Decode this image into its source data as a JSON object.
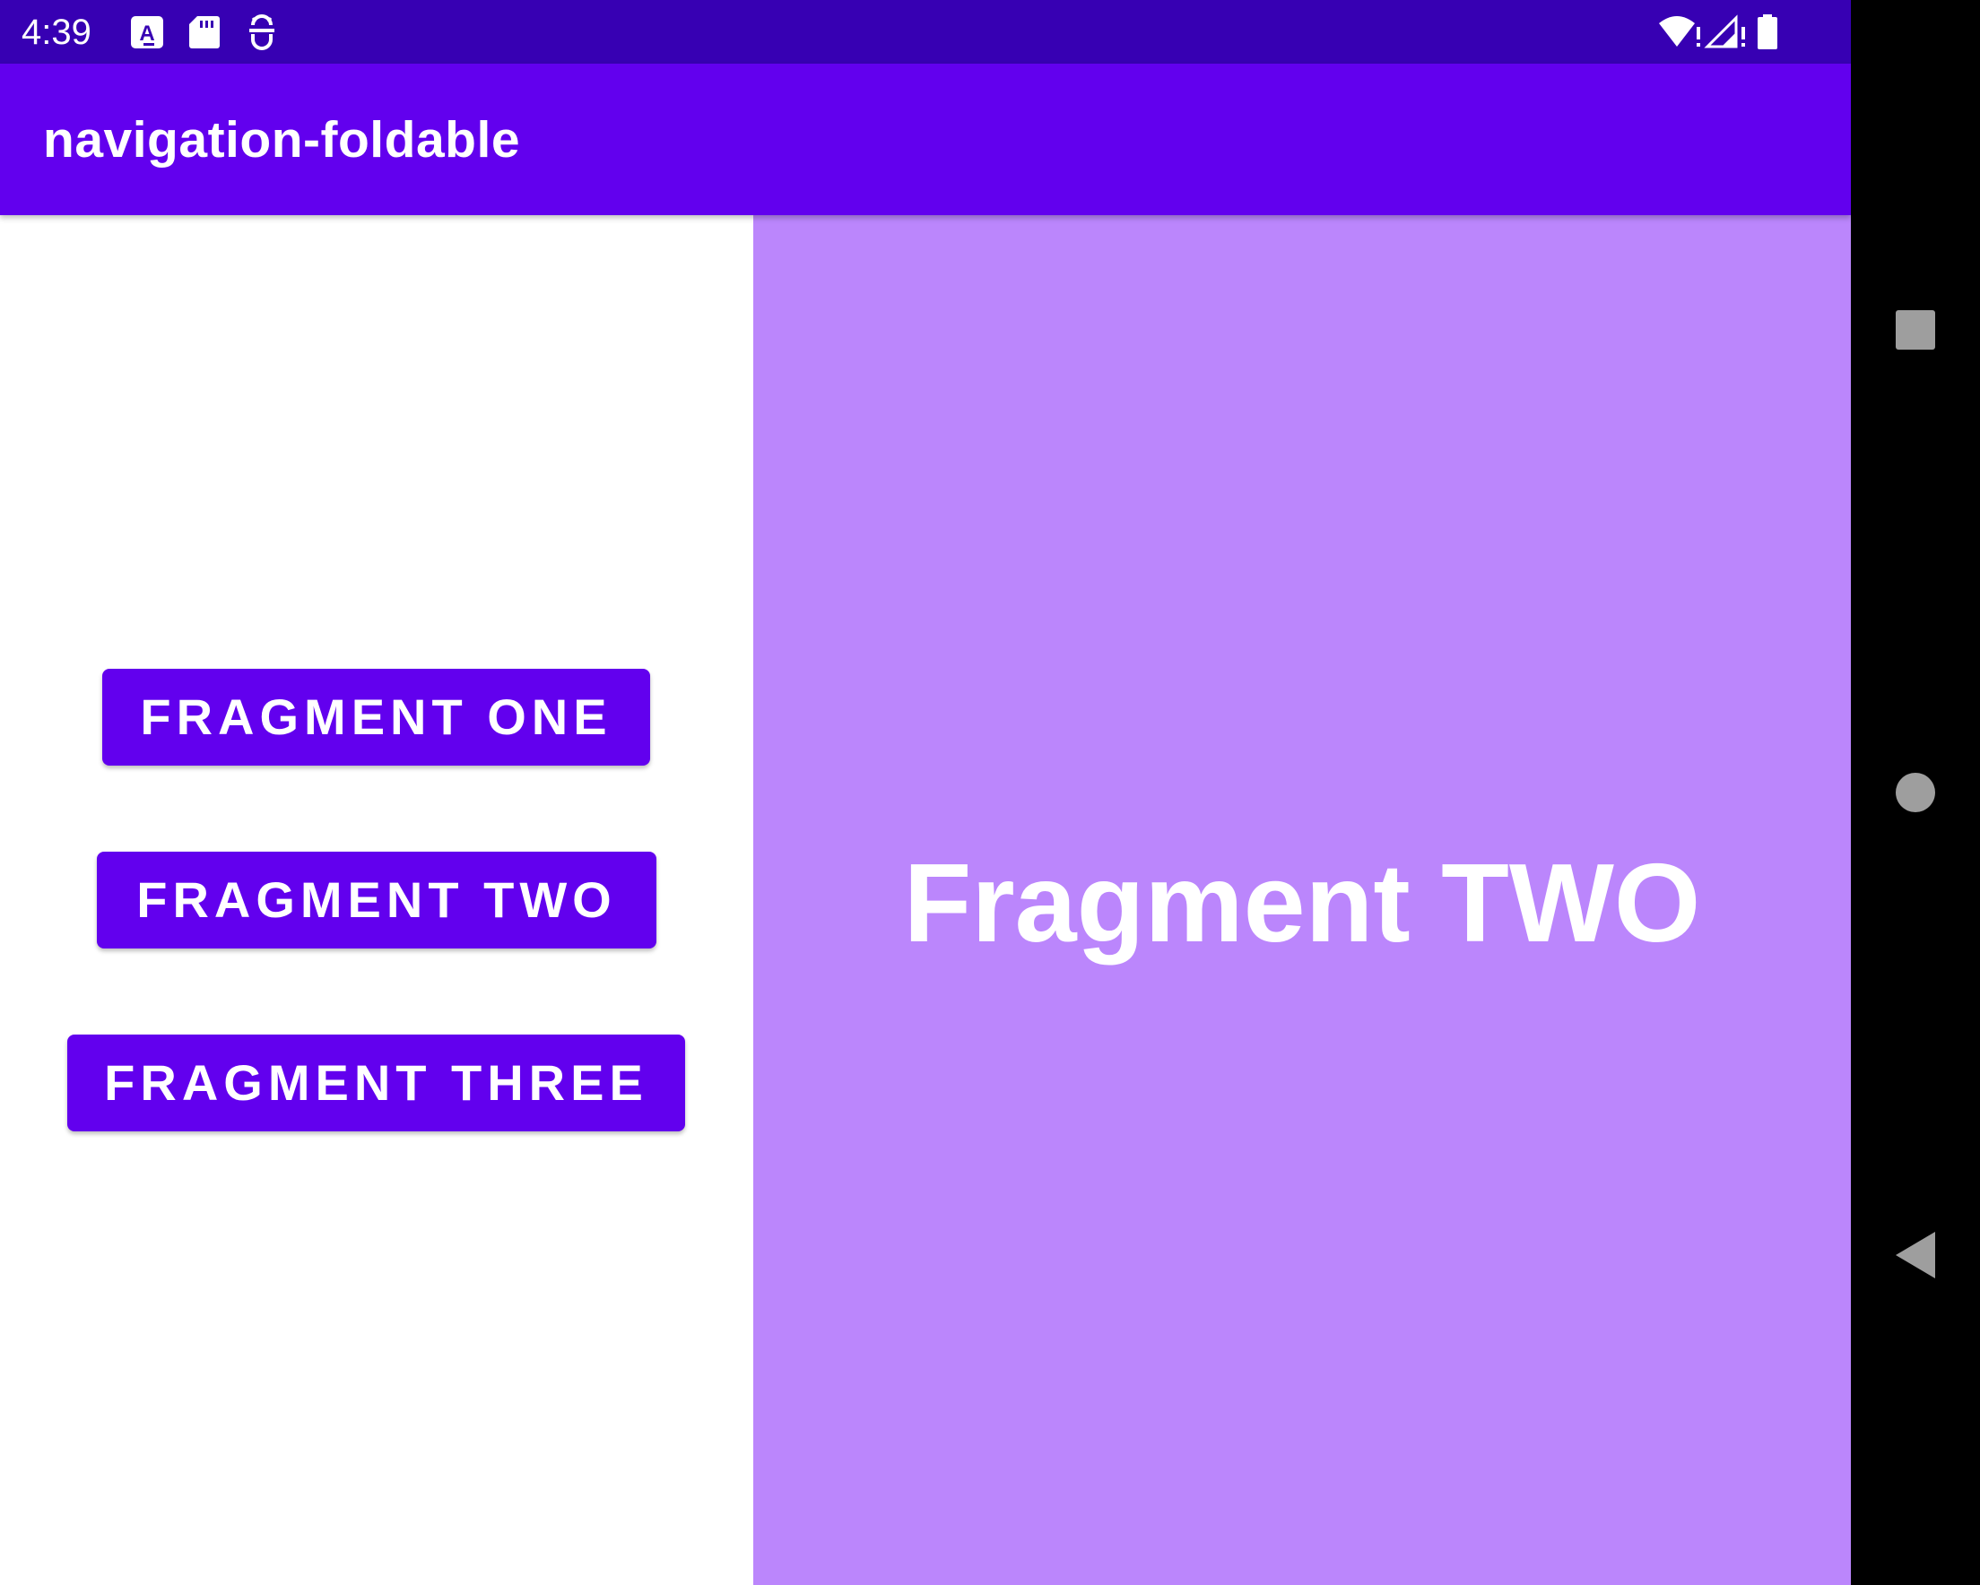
{
  "status_bar": {
    "time": "4:39",
    "icons": [
      "accessibility-a-icon",
      "sd-card-icon",
      "debug-icon",
      "wifi-alert-icon",
      "signal-alert-icon",
      "battery-icon"
    ]
  },
  "app_bar": {
    "title": "navigation-foldable"
  },
  "list_pane": {
    "buttons": [
      {
        "label": "FRAGMENT ONE"
      },
      {
        "label": "FRAGMENT TWO"
      },
      {
        "label": "FRAGMENT THREE"
      }
    ]
  },
  "detail_pane": {
    "text": "Fragment TWO"
  },
  "nav_bar": {
    "buttons": [
      "recents-square-icon",
      "home-circle-icon",
      "back-triangle-icon"
    ]
  },
  "colors": {
    "status_bar": "#3700b3",
    "primary": "#6200ee",
    "detail_background": "#bb86fc",
    "on_primary": "#ffffff"
  }
}
